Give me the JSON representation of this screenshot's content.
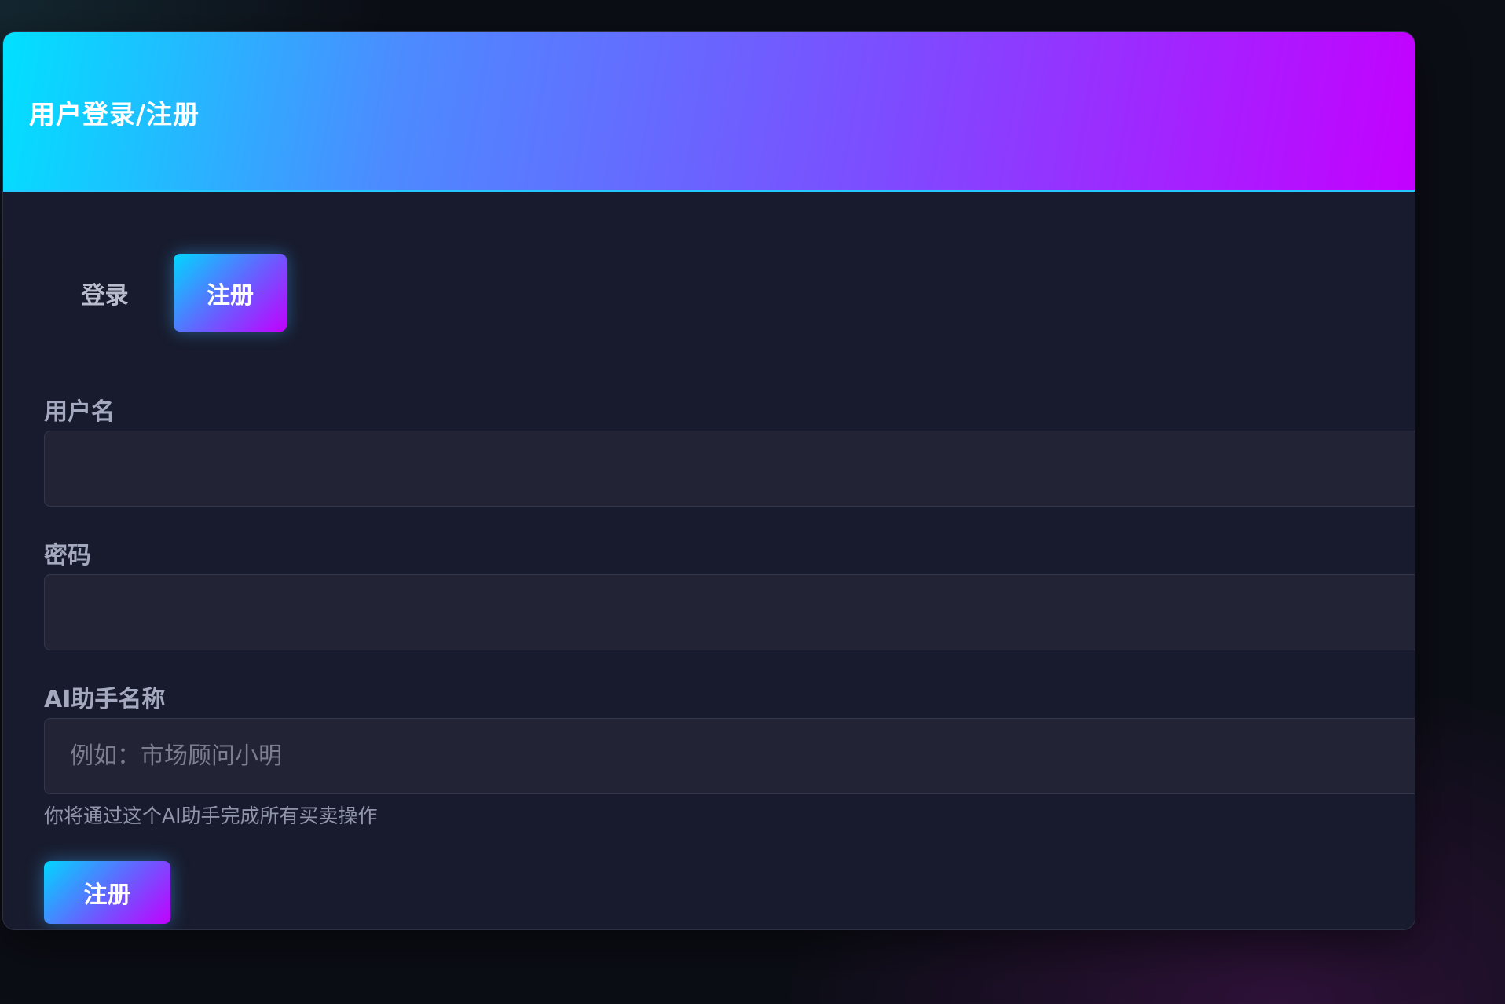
{
  "header": {
    "title": "用户登录/注册"
  },
  "tabs": {
    "login_label": "登录",
    "register_label": "注册",
    "active": "register"
  },
  "form": {
    "username": {
      "label": "用户名",
      "value": "",
      "placeholder": ""
    },
    "password": {
      "label": "密码",
      "value": "",
      "placeholder": ""
    },
    "assistant_name": {
      "label": "AI助手名称",
      "value": "",
      "placeholder": "例如：市场顾问小明",
      "hint": "你将通过这个AI助手完成所有买卖操作"
    },
    "submit_label": "注册"
  },
  "colors": {
    "gradient_start": "#00e1ff",
    "gradient_end": "#c400ff",
    "card_background": "#181b2d",
    "input_background": "#222436",
    "page_background": "#0c0e16"
  }
}
